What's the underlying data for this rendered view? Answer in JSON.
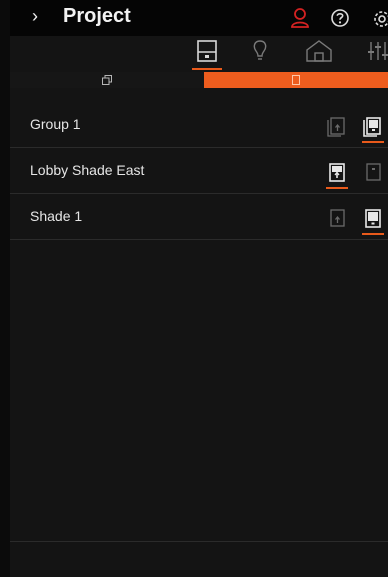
{
  "header": {
    "chevron": "›",
    "title": "Project",
    "icons": [
      "user-icon",
      "help-icon",
      "settings-icon"
    ],
    "user_icon_color": "#d42222"
  },
  "category_tabs": [
    {
      "icon": "shade-icon",
      "active": true
    },
    {
      "icon": "bulb-icon",
      "active": false
    },
    {
      "icon": "home-icon",
      "active": false
    },
    {
      "icon": "sliders-icon",
      "active": false
    }
  ],
  "sub_tabs": [
    {
      "icon": "groups-icon",
      "active": false
    },
    {
      "icon": "single-shade-icon",
      "active": true
    }
  ],
  "shades": [
    {
      "name": "Group 1",
      "selected_mode": "lowered"
    },
    {
      "name": "Lobby Shade East",
      "selected_mode": "raised"
    },
    {
      "name": "Shade 1",
      "selected_mode": "lowered"
    }
  ],
  "colors": {
    "accent": "#e95a1b",
    "background": "#141414",
    "header": "#050505"
  }
}
